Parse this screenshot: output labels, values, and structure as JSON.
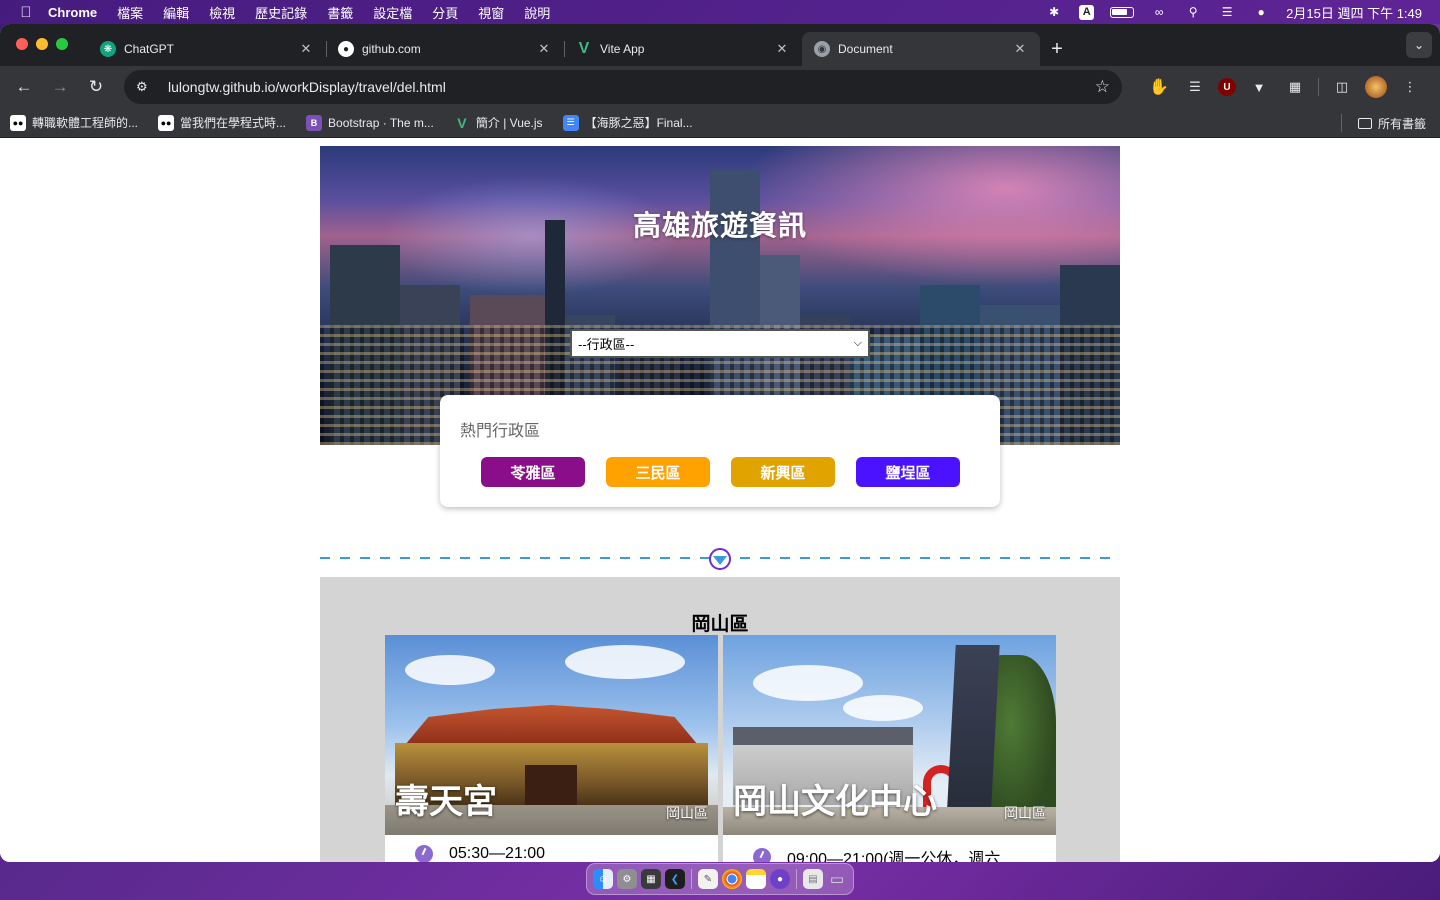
{
  "menubar": {
    "app_name": "Chrome",
    "items": [
      "檔案",
      "編輯",
      "檢視",
      "歷史記錄",
      "書籤",
      "設定檔",
      "分頁",
      "視窗",
      "說明"
    ],
    "input_indicator": "A",
    "datetime": "2月15日 週四 下午 1:49"
  },
  "tabs": [
    {
      "title": "ChatGPT",
      "icon": "chatgpt-icon",
      "color": "#10a37f"
    },
    {
      "title": "github.com",
      "icon": "github-icon",
      "color": "#ffffff"
    },
    {
      "title": "Vite App",
      "icon": "vue-icon",
      "color": "#41b883"
    },
    {
      "title": "Document",
      "icon": "globe-icon",
      "color": "#9aa0a6"
    }
  ],
  "active_tab_index": 3,
  "address_bar": {
    "url": "lulongtw.github.io/workDisplay/travel/del.html"
  },
  "bookmarks": [
    {
      "label": "轉職軟體工程師的...",
      "icon": "medium-icon"
    },
    {
      "label": "當我們在學程式時...",
      "icon": "medium-icon"
    },
    {
      "label": "Bootstrap · The m...",
      "icon": "bootstrap-icon"
    },
    {
      "label": "簡介 | Vue.js",
      "icon": "vue-icon"
    },
    {
      "label": "【海豚之惡】Final...",
      "icon": "docs-icon"
    }
  ],
  "bookmarks_folder": "所有書籤",
  "page": {
    "hero_title": "高雄旅遊資訊",
    "select_value": "--行政區--",
    "hot_title": "熱門行政區",
    "hot_districts": [
      {
        "label": "苓雅區",
        "color": "#8a0d8a"
      },
      {
        "label": "三民區",
        "color": "#ffa200"
      },
      {
        "label": "新興區",
        "color": "#e0a300"
      },
      {
        "label": "鹽埕區",
        "color": "#4b12ff"
      }
    ],
    "list_title": "岡山區",
    "cards": [
      {
        "name": "壽天宮",
        "zone": "岡山區",
        "hours": "05:30—21:00"
      },
      {
        "name": "岡山文化中心",
        "zone": "岡山區",
        "hours": "09:00—21:00(週一公休，週六"
      }
    ]
  }
}
